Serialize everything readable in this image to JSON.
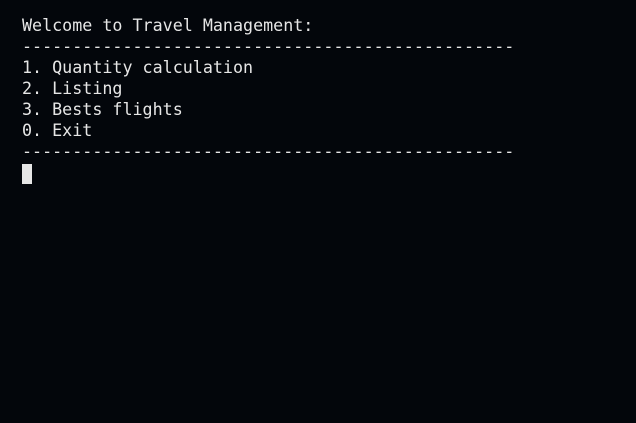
{
  "terminal": {
    "title_line": "Welcome to Travel Management:",
    "separator": "-------------------------------------------------",
    "menu": [
      {
        "label": "1. Quantity calculation"
      },
      {
        "label": "2. Listing"
      },
      {
        "label": "3. Bests flights"
      },
      {
        "label": "0. Exit"
      }
    ],
    "separator_bottom": "-------------------------------------------------"
  },
  "colors": {
    "background": "#03060b",
    "foreground": "#e6e6e6"
  }
}
